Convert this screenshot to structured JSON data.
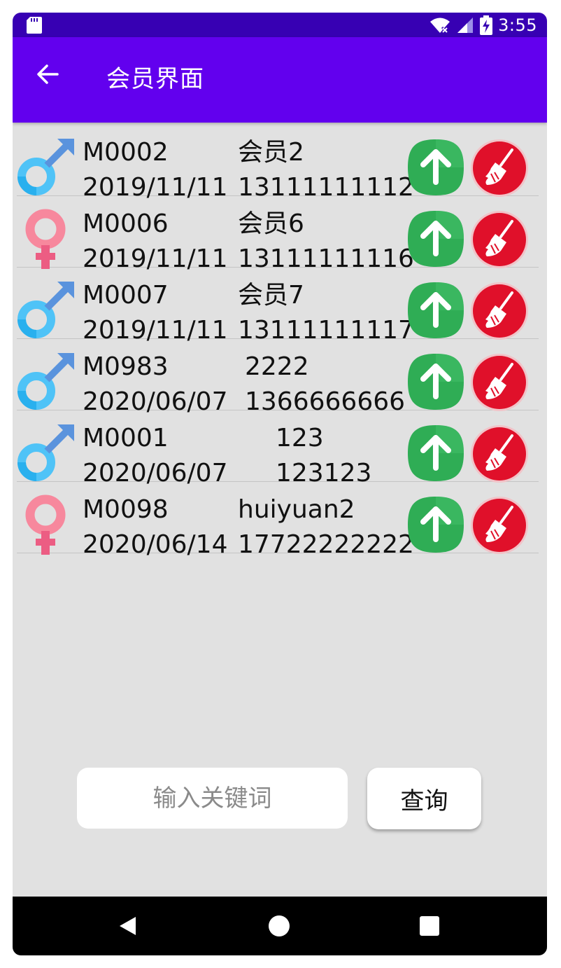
{
  "status_bar": {
    "time": "3:55"
  },
  "app_bar": {
    "title": "会员界面"
  },
  "members": [
    {
      "gender": "male",
      "code": "M0002",
      "name": "会员2",
      "date": "2019/11/11",
      "phone": "13111111112"
    },
    {
      "gender": "female",
      "code": "M0006",
      "name": "会员6",
      "date": "2019/11/11",
      "phone": "13111111116"
    },
    {
      "gender": "male",
      "code": "M0007",
      "name": "会员7",
      "date": "2019/11/11",
      "phone": "13111111117"
    },
    {
      "gender": "male",
      "code": "M0983",
      "name": "2222",
      "date": "2020/06/07",
      "phone": "1366666666"
    },
    {
      "gender": "male",
      "code": "M0001",
      "name": "123",
      "date": "2020/06/07",
      "phone": "123123"
    },
    {
      "gender": "female",
      "code": "M0098",
      "name": "huiyuan2",
      "date": "2020/06/14",
      "phone": "17722222222"
    }
  ],
  "search": {
    "placeholder": "输入关键词",
    "value": "",
    "button_label": "查询"
  },
  "icons": {
    "row_update": "arrow-up-icon",
    "row_delete": "broom-icon",
    "male": "male-symbol-icon",
    "female": "female-symbol-icon"
  },
  "colors": {
    "status_bar": "#3700b3",
    "app_bar": "#6200ee",
    "update_button": "#2fad55",
    "delete_button": "#e0102a",
    "male": "#4fc3f7",
    "female": "#f06e88"
  }
}
